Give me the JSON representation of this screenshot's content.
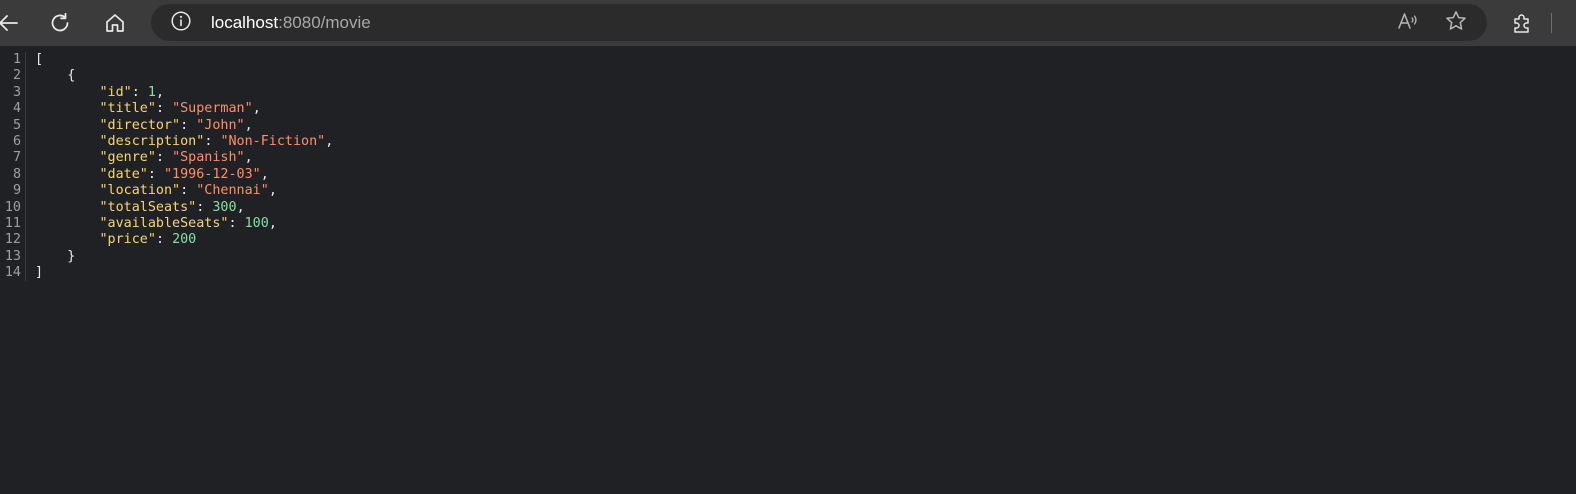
{
  "browser": {
    "url_host": "localhost",
    "url_rest": ":8080/movie",
    "icons": {
      "back": "back-arrow-icon",
      "refresh": "refresh-icon",
      "home": "home-icon",
      "site_info": "info-icon",
      "read_aloud": "read-aloud-icon",
      "favorite": "star-icon",
      "extensions": "puzzle-piece-icon"
    }
  },
  "json_viewer": {
    "line_numbers": [
      "1",
      "2",
      "3",
      "4",
      "5",
      "6",
      "7",
      "8",
      "9",
      "10",
      "11",
      "12",
      "13",
      "14"
    ],
    "open_bracket": "[",
    "open_brace": "{",
    "close_brace": "}",
    "close_bracket": "]",
    "properties": [
      {
        "key": "\"id\"",
        "value": "1",
        "type": "number",
        "comma": ","
      },
      {
        "key": "\"title\"",
        "value": "\"Superman\"",
        "type": "string",
        "comma": ","
      },
      {
        "key": "\"director\"",
        "value": "\"John\"",
        "type": "string",
        "comma": ","
      },
      {
        "key": "\"description\"",
        "value": "\"Non-Fiction\"",
        "type": "string",
        "comma": ","
      },
      {
        "key": "\"genre\"",
        "value": "\"Spanish\"",
        "type": "string",
        "comma": ","
      },
      {
        "key": "\"date\"",
        "value": "\"1996-12-03\"",
        "type": "string",
        "comma": ","
      },
      {
        "key": "\"location\"",
        "value": "\"Chennai\"",
        "type": "string",
        "comma": ","
      },
      {
        "key": "\"totalSeats\"",
        "value": "300",
        "type": "number",
        "comma": ","
      },
      {
        "key": "\"availableSeats\"",
        "value": "100",
        "type": "number",
        "comma": ","
      },
      {
        "key": "\"price\"",
        "value": "200",
        "type": "number",
        "comma": ""
      }
    ]
  },
  "colors": {
    "toolbar_bg": "#3b3b3b",
    "address_bg": "#2b2b2b",
    "page_bg": "#202124",
    "json_key": "#f7d572",
    "json_string": "#ff8f6b",
    "json_number": "#84e0a3"
  }
}
